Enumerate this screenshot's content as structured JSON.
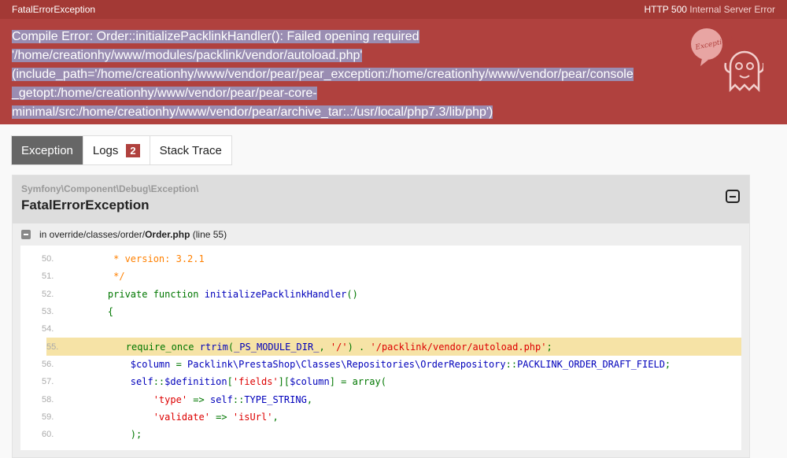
{
  "topbar": {
    "exception_name": "FatalErrorException",
    "status_code": "HTTP 500",
    "status_text": "Internal Server Error"
  },
  "message": [
    "Compile Error: Order::initializePacklinkHandler(): Failed opening required",
    "'/home/creationhy/www/modules/packlink/vendor/autoload.php'",
    "(include_path='/home/creationhy/www/vendor/pear/pear_exception:/home/creationhy/www/vendor/pear/console",
    "_getopt:/home/creationhy/www/vendor/pear/pear-core-",
    "minimal/src:/home/creationhy/www/vendor/pear/archive_tar:.:/usr/local/php7.3/lib/php')"
  ],
  "logo_text": "Exception!",
  "tabs": [
    {
      "label": "Exception",
      "active": true
    },
    {
      "label": "Logs",
      "badge": "2"
    },
    {
      "label": "Stack Trace"
    }
  ],
  "exception": {
    "namespace": "Symfony\\Component\\Debug\\Exception\\",
    "class": "FatalErrorException",
    "file_prefix": "in override/classes/order/",
    "file_name": "Order.php",
    "file_line": "(line 55)"
  },
  "colors": {
    "header": "#a33935",
    "hero": "#b0413e",
    "highlight_line": "#f6e3a6",
    "keyword": "#007700",
    "default": "#0000bb",
    "string": "#dd0000",
    "comment": "#ff8000"
  },
  "code": [
    {
      "num": "50.",
      "t": [
        [
          "c",
          "     * version: 3.2.1"
        ]
      ]
    },
    {
      "num": "51.",
      "t": [
        [
          "c",
          "     */"
        ]
      ]
    },
    {
      "num": "52.",
      "t": [
        [
          "k",
          "    private function "
        ],
        [
          "d",
          "initializePacklinkHandler"
        ],
        [
          "k",
          "()"
        ]
      ]
    },
    {
      "num": "53.",
      "t": [
        [
          "k",
          "    {"
        ]
      ]
    },
    {
      "num": "54.",
      "t": []
    },
    {
      "num": "55.",
      "hl": true,
      "t": [
        [
          "k",
          "        require_once "
        ],
        [
          "d",
          "rtrim"
        ],
        [
          "k",
          "("
        ],
        [
          "d",
          "_PS_MODULE_DIR_"
        ],
        [
          "k",
          ", "
        ],
        [
          "s",
          "'/'"
        ],
        [
          "k",
          ") . "
        ],
        [
          "s",
          "'/packlink/vendor/autoload.php'"
        ],
        [
          "k",
          ";"
        ]
      ]
    },
    {
      "num": "56.",
      "t": [
        [
          "d",
          "        $column "
        ],
        [
          "k",
          "= "
        ],
        [
          "d",
          "Packlink\\PrestaShop\\Classes\\Repositories\\OrderRepository"
        ],
        [
          "k",
          "::"
        ],
        [
          "d",
          "PACKLINK_ORDER_DRAFT_FIELD"
        ],
        [
          "k",
          ";"
        ]
      ]
    },
    {
      "num": "57.",
      "t": [
        [
          "d",
          "        self"
        ],
        [
          "k",
          "::"
        ],
        [
          "d",
          "$definition"
        ],
        [
          "k",
          "["
        ],
        [
          "s",
          "'fields'"
        ],
        [
          "k",
          "]["
        ],
        [
          "d",
          "$column"
        ],
        [
          "k",
          "] = array("
        ]
      ]
    },
    {
      "num": "58.",
      "t": [
        [
          "s",
          "            'type' "
        ],
        [
          "k",
          "=> "
        ],
        [
          "d",
          "self"
        ],
        [
          "k",
          "::"
        ],
        [
          "d",
          "TYPE_STRING"
        ],
        [
          "k",
          ","
        ]
      ]
    },
    {
      "num": "59.",
      "t": [
        [
          "s",
          "            'validate' "
        ],
        [
          "k",
          "=> "
        ],
        [
          "s",
          "'isUrl'"
        ],
        [
          "k",
          ","
        ]
      ]
    },
    {
      "num": "60.",
      "t": [
        [
          "k",
          "        );"
        ]
      ]
    }
  ]
}
